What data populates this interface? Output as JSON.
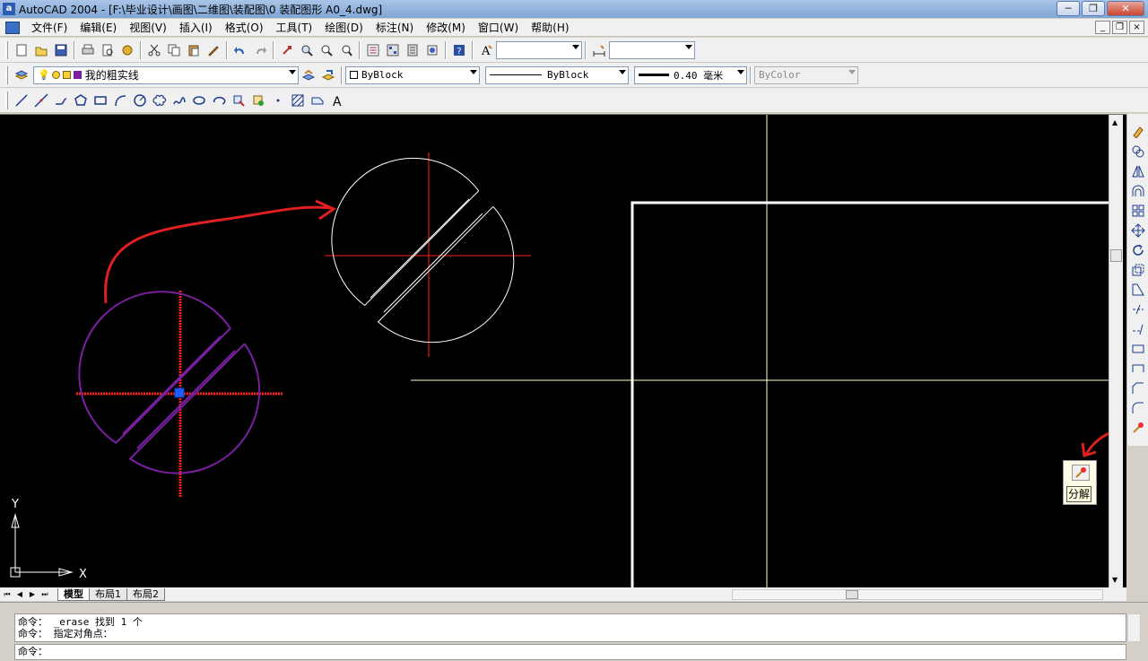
{
  "window": {
    "title": "AutoCAD 2004 - [F:\\毕业设计\\画图\\二维图\\装配图\\0 装配图形 A0_4.dwg]",
    "app_icon": "a"
  },
  "menubar": {
    "items": [
      "文件(F)",
      "编辑(E)",
      "视图(V)",
      "插入(I)",
      "格式(O)",
      "工具(T)",
      "绘图(D)",
      "标注(N)",
      "修改(M)",
      "窗口(W)",
      "帮助(H)"
    ]
  },
  "properties": {
    "layer": "我的粗实线",
    "color": "ByBlock",
    "linetype": "ByBlock",
    "lineweight": "0.40 毫米",
    "plotstyle": "ByColor"
  },
  "tabs": [
    "模型",
    "布局1",
    "布局2"
  ],
  "active_tab": "模型",
  "axes": {
    "x": "X",
    "y": "Y"
  },
  "tooltip": {
    "label": "分解"
  },
  "command": {
    "history": [
      "命令： _erase 找到 1 个",
      "命令： 指定对角点："
    ],
    "prompt": "命令："
  },
  "colors": {
    "canvas": "#000000",
    "accent_red": "#e02020",
    "selection_purple": "#7a1fa0",
    "center_red": "#ff2020"
  }
}
